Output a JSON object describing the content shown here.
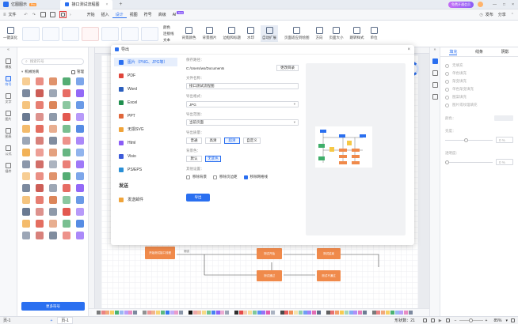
{
  "titlebar": {
    "app_name": "亿图图示",
    "pro_badge": "Pro",
    "doc_tab": "接口测试流程图",
    "new_tab": "+",
    "vip_button": "免费开通会员",
    "login_hint": "登录"
  },
  "menubar": {
    "file": "文件",
    "tabs": [
      "开始",
      "插入",
      "设计",
      "视图",
      "符号",
      "高级",
      "AI"
    ],
    "active_tab": "设计",
    "ai_badge": "New",
    "publish": "发布",
    "share": "分享"
  },
  "ribbon": {
    "brush_label": "一键美化",
    "group_color": "颜色",
    "group_connector": "连接线",
    "group_text": "文本",
    "items": [
      "背景颜色",
      "背景图片",
      "边框和标题",
      "水印",
      "自动扩展",
      "页面适应到绘图",
      "方向",
      "页面大小",
      "跳转样式",
      "单位"
    ]
  },
  "leftnav": {
    "items": [
      "模板",
      "符号",
      "文字",
      "图片",
      "图表",
      "公式",
      "插件"
    ],
    "active": "符号"
  },
  "symbols": {
    "search_placeholder": "搜索符号",
    "library_label": "机械仿真",
    "manage_label": "管理",
    "more_button": "更多符号"
  },
  "export_dialog": {
    "title": "导出",
    "formats": [
      "图片（PNG、JPG等）",
      "PDF",
      "Word",
      "Excel",
      "PPT",
      "无损SVG",
      "Html",
      "Visio",
      "PS/EPS"
    ],
    "active_format": "图片（PNG、JPG等）",
    "send_section": "发送",
    "send_email": "发送邮件",
    "save_path_label": "保存路径：",
    "save_path_value": "C:/Users/ws/Documents",
    "change_dir_button": "更改目录",
    "filename_label": "文件名称：",
    "filename_value": "接口测试流程图",
    "format_label": "导出格式：",
    "format_value": "JPG",
    "range_label": "导出范围：",
    "range_value": "当前页面",
    "quality_label": "导出质量：",
    "quality_options": [
      "普通",
      "高清",
      "超清",
      "自定义"
    ],
    "quality_selected": "超清",
    "bg_label": "背景色：",
    "bg_options": [
      "默认",
      "无底色"
    ],
    "bg_selected": "无底色",
    "other_label": "其他设置：",
    "options": [
      {
        "label": "移除背景",
        "checked": false
      },
      {
        "label": "移除页边距",
        "checked": false
      },
      {
        "label": "移除网格线",
        "checked": true
      }
    ],
    "export_button": "导出"
  },
  "canvas": {
    "shape_labels": [
      "开始测试接口流程",
      "测试开始",
      "测试结束",
      "测试通过",
      "测试不通过"
    ],
    "edge_label": "测试"
  },
  "rightpanel": {
    "tabs": [
      "填充",
      "线条",
      "阴影"
    ],
    "active_tab": "填充",
    "fill_options": [
      "无填充",
      "单色填充",
      "渐变填充",
      "单色渐变填充",
      "图案填充",
      "图片或纹理填充"
    ],
    "color_label": "颜色：",
    "brightness_label": "亮度：",
    "brightness_value": "0 %",
    "transparency_label": "透明度：",
    "transparency_value": "0 %"
  },
  "statusbar": {
    "page_selector": "页-1",
    "page_tab": "页-1",
    "add_page": "+",
    "shape_count_label": "形状数：",
    "shape_count": "21",
    "zoom": "85%"
  },
  "colors": {
    "accent": "#2a6ff0",
    "flow_orange": "#f08a4b",
    "canvas_bg": "#e9ebef",
    "highlight_red": "#e23b3b"
  }
}
